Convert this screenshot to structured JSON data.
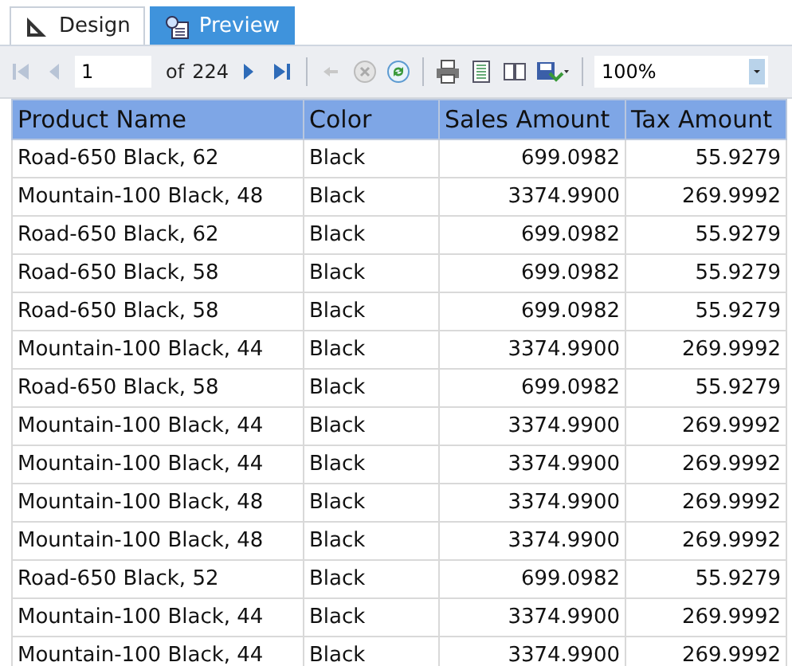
{
  "tabs": [
    {
      "label": "Design",
      "kind": "design",
      "selected": false
    },
    {
      "label": "Preview",
      "kind": "preview",
      "selected": true
    }
  ],
  "toolbar": {
    "page": "1",
    "of_label": "of",
    "page_count": "224",
    "zoom": "100%"
  },
  "table": {
    "columns": [
      "Product Name",
      "Color",
      "Sales Amount",
      "Tax Amount"
    ],
    "rows": [
      [
        "Road-650 Black, 62",
        "Black",
        "699.0982",
        "55.9279"
      ],
      [
        "Mountain-100 Black, 48",
        "Black",
        "3374.9900",
        "269.9992"
      ],
      [
        "Road-650 Black, 62",
        "Black",
        "699.0982",
        "55.9279"
      ],
      [
        "Road-650 Black, 58",
        "Black",
        "699.0982",
        "55.9279"
      ],
      [
        "Road-650 Black, 58",
        "Black",
        "699.0982",
        "55.9279"
      ],
      [
        "Mountain-100 Black, 44",
        "Black",
        "3374.9900",
        "269.9992"
      ],
      [
        "Road-650 Black, 58",
        "Black",
        "699.0982",
        "55.9279"
      ],
      [
        "Mountain-100 Black, 44",
        "Black",
        "3374.9900",
        "269.9992"
      ],
      [
        "Mountain-100 Black, 44",
        "Black",
        "3374.9900",
        "269.9992"
      ],
      [
        "Mountain-100 Black, 48",
        "Black",
        "3374.9900",
        "269.9992"
      ],
      [
        "Mountain-100 Black, 48",
        "Black",
        "3374.9900",
        "269.9992"
      ],
      [
        "Road-650 Black, 52",
        "Black",
        "699.0982",
        "55.9279"
      ],
      [
        "Mountain-100 Black, 44",
        "Black",
        "3374.9900",
        "269.9992"
      ],
      [
        "Mountain-100 Black, 44",
        "Black",
        "3374.9900",
        "269.9992"
      ]
    ]
  }
}
